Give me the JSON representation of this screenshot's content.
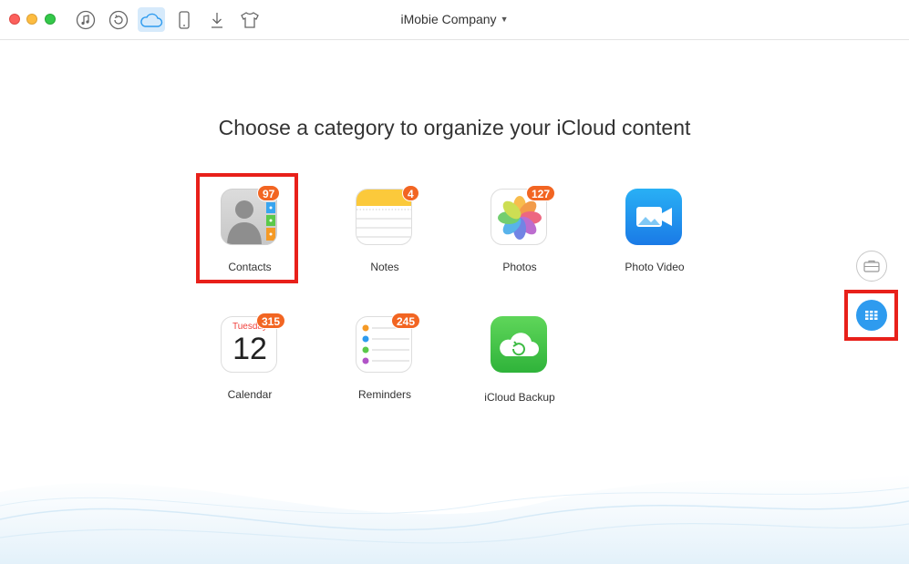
{
  "window": {
    "device_name": "iMobie Company",
    "toolbar": [
      {
        "icon": "music-note-icon"
      },
      {
        "icon": "history-icon"
      },
      {
        "icon": "icloud-icon",
        "active": true
      },
      {
        "icon": "phone-icon"
      },
      {
        "icon": "download-icon"
      },
      {
        "icon": "tshirt-icon"
      }
    ]
  },
  "main": {
    "heading": "Choose a category to organize your iCloud content",
    "categories": [
      {
        "label": "Contacts",
        "badge": "97"
      },
      {
        "label": "Notes",
        "badge": "4"
      },
      {
        "label": "Photos",
        "badge": "127"
      },
      {
        "label": "Photo Video",
        "badge": ""
      },
      {
        "label": "Calendar",
        "badge": "315",
        "weekday": "Tuesday",
        "day": "12"
      },
      {
        "label": "Reminders",
        "badge": "245"
      },
      {
        "label": "iCloud Backup",
        "badge": ""
      }
    ]
  },
  "side_panel": {
    "buttons": [
      {
        "icon": "toolbox-icon"
      },
      {
        "icon": "grid-icon",
        "active": true
      }
    ]
  },
  "colors": {
    "accent": "#2e9bef",
    "badge": "#f26522",
    "highlight": "#e8201a"
  }
}
